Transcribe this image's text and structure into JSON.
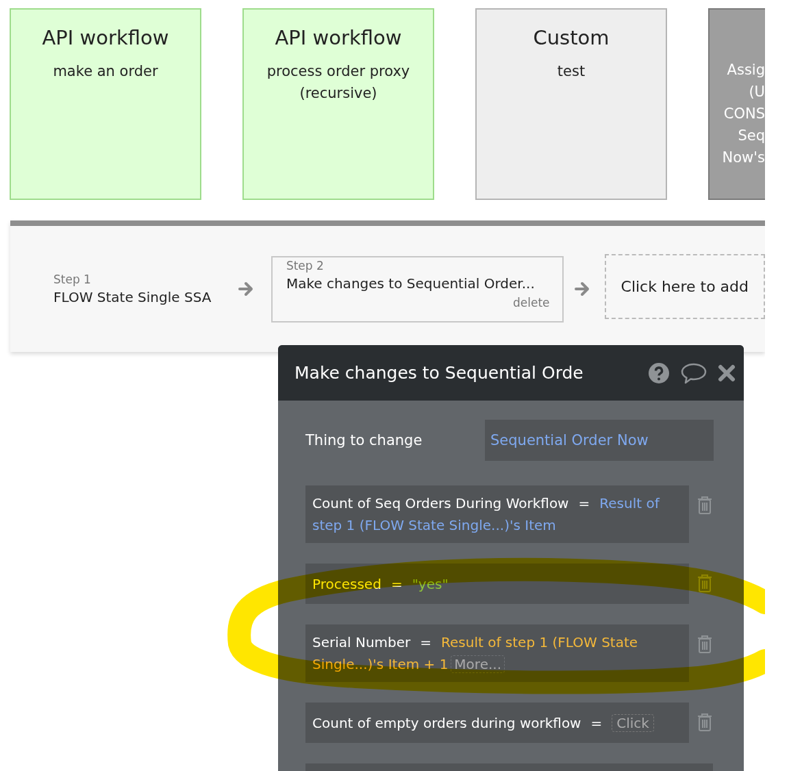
{
  "cards": [
    {
      "kind": "api",
      "title": "API workflow",
      "subtitle": "make an order"
    },
    {
      "kind": "api",
      "title": "API workflow",
      "subtitle": "process order proxy (recursive)"
    },
    {
      "kind": "custom",
      "title": "Custom",
      "subtitle": "test"
    },
    {
      "kind": "action",
      "lines": [
        "Assig",
        "(U",
        "CONS",
        "Seq",
        "Now's"
      ]
    }
  ],
  "steps": [
    {
      "label": "Step 1",
      "name": "FLOW State Single SSA",
      "selected": false
    },
    {
      "label": "Step 2",
      "name": "Make changes to Sequential Order...",
      "selected": true,
      "delete": "delete"
    }
  ],
  "add_step": "Click here to add",
  "panel": {
    "title": "Make changes to Sequential Orde",
    "thing_label": "Thing to change",
    "thing_value": "Sequential Order Now",
    "fields": [
      {
        "kind": "dynamic",
        "name": "Count of Seq Orders During Workflow",
        "operator": "=",
        "value": "Result of step 1 (FLOW State Single...)'s Item"
      },
      {
        "kind": "text",
        "name": "Processed",
        "operator": "=",
        "value": "\"yes\""
      },
      {
        "kind": "expression",
        "name": "Serial Number",
        "operator": "=",
        "value": "Result of step 1 (FLOW State Single...)'s Item + 1",
        "more": "More..."
      },
      {
        "kind": "empty",
        "name": "Count of empty orders during workflow",
        "operator": "=",
        "value": "Click"
      },
      {
        "kind": "blank"
      }
    ]
  },
  "annotation": {
    "kind": "highlighter-loop"
  }
}
